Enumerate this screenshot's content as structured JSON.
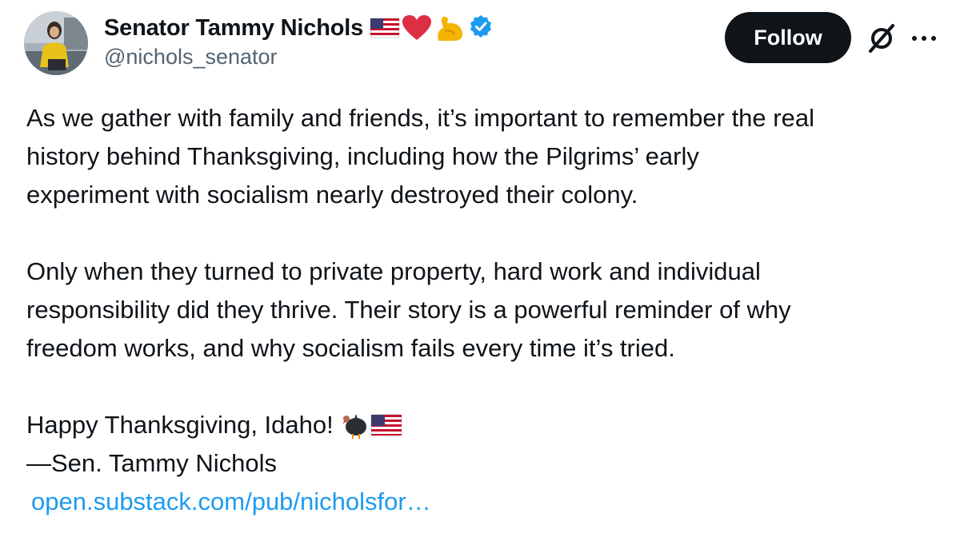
{
  "author": {
    "display_name": "Senator Tammy Nichols",
    "handle": "@nichols_senator",
    "name_emoji_icons": [
      "us-flag-icon",
      "red-heart-icon",
      "flexed-biceps-icon"
    ],
    "verified_color": "#1d9bf0"
  },
  "actions": {
    "follow_label": "Follow",
    "grok_icon": "grok-slash-icon",
    "more_icon": "more-dots-icon"
  },
  "tweet": {
    "paragraph_1": "As we gather with family and friends, it’s important to remember the real\nhistory behind Thanksgiving, including how the Pilgrims’ early\nexperiment with socialism nearly destroyed their colony.",
    "paragraph_2": "Only when they turned to private property, hard work and individual\nresponsibility did they thrive. Their story is a powerful reminder of why\nfreedom works, and why socialism fails every time it’s tried.",
    "greeting": "Happy Thanksgiving, Idaho!",
    "greeting_emoji_icons": [
      "turkey-icon",
      "us-flag-icon"
    ],
    "signature": "—Sen. Tammy Nichols",
    "link_text": "open.substack.com/pub/nicholsfor…"
  },
  "colors": {
    "text_primary": "#0f1419",
    "text_secondary": "#536471",
    "link": "#1d9bf0",
    "button_bg": "#0f1419",
    "button_text": "#ffffff"
  }
}
